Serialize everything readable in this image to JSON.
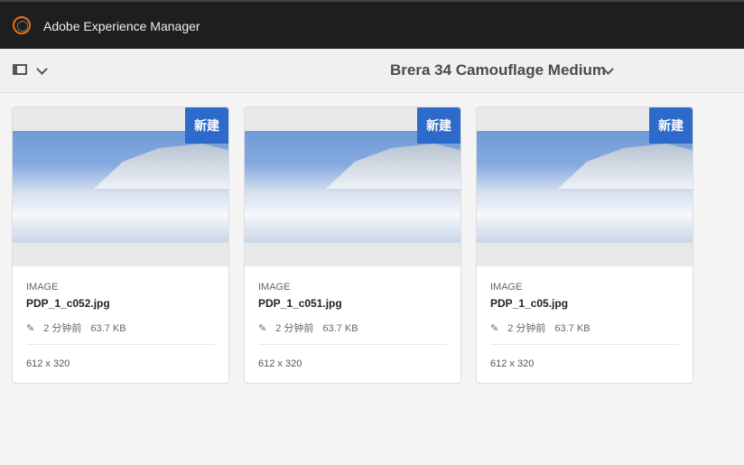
{
  "header": {
    "title": "Adobe Experience Manager"
  },
  "toolbar": {
    "page_title": "Brera 34 Camouflage Medium"
  },
  "cards": [
    {
      "badge": "新建",
      "type": "IMAGE",
      "name": "PDP_1_c052.jpg",
      "modified": "2 分钟前",
      "size": "63.7 KB",
      "dimensions": "612 x 320"
    },
    {
      "badge": "新建",
      "type": "IMAGE",
      "name": "PDP_1_c051.jpg",
      "modified": "2 分钟前",
      "size": "63.7 KB",
      "dimensions": "612 x 320"
    },
    {
      "badge": "新建",
      "type": "IMAGE",
      "name": "PDP_1_c05.jpg",
      "modified": "2 分钟前",
      "size": "63.7 KB",
      "dimensions": "612 x 320"
    }
  ]
}
